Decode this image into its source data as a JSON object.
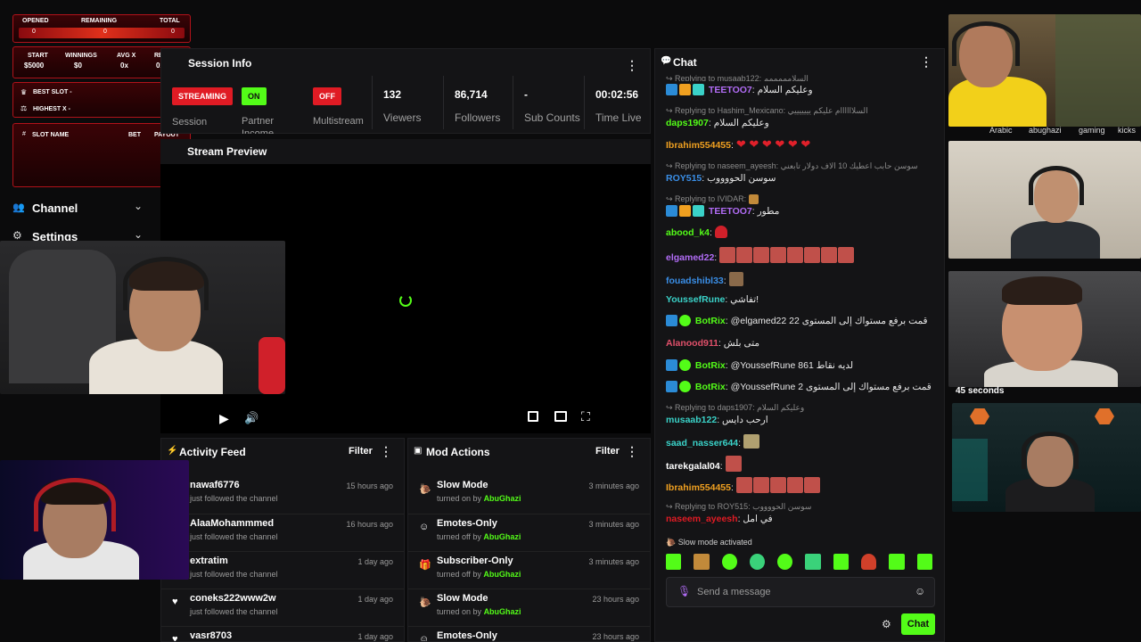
{
  "overlay": {
    "headers": {
      "opened": "OPENED",
      "remaining": "REMAINING",
      "total": "TOTAL"
    },
    "values": {
      "opened": "0",
      "remaining": "0",
      "total": "0"
    },
    "stats_labels": {
      "start": "START",
      "winnings": "WINNINGS",
      "avg": "AVG X",
      "req": "REQ X"
    },
    "stats_values": {
      "start": "$5000",
      "winnings": "$0",
      "avg": "0x",
      "req": "0x"
    },
    "best_slot": "BEST SLOT -",
    "highest_x": "HIGHEST X -",
    "table_headers": {
      "slot": "SLOT NAME",
      "bet": "BET",
      "payout": "PAYOUT"
    }
  },
  "sidebar": {
    "channel": "Channel",
    "settings": "Settings"
  },
  "session": {
    "title": "Session Info",
    "streaming_badge": "STREAMING",
    "partner_badge": "ON",
    "partner_label": "Partner",
    "partner_sub": "Income",
    "multistream_badge": "OFF",
    "multistream_label": "Multistream",
    "viewers_value": "132",
    "viewers_label": "Viewers",
    "followers_value": "86,714",
    "followers_label": "Followers",
    "subs_value": "-",
    "subs_label": "Sub Counts",
    "time_value": "00:02:56",
    "time_label": "Time Live",
    "session_sub": "Session"
  },
  "preview": {
    "title": "Stream Preview"
  },
  "activity": {
    "title": "Activity Feed",
    "filter": "Filter",
    "items": [
      {
        "name": "nawaf6776",
        "sub": "just followed the channel",
        "time": "15 hours ago"
      },
      {
        "name": "AlaaMohammmed",
        "sub": "just followed the channel",
        "time": "16 hours ago"
      },
      {
        "name": "extratim",
        "sub": "just followed the channel",
        "time": "1 day ago"
      },
      {
        "name": "coneks222www2w",
        "sub": "just followed the channel",
        "time": "1 day ago"
      },
      {
        "name": "vasr8703",
        "sub": "",
        "time": "1 day ago"
      }
    ]
  },
  "mod": {
    "title": "Mod Actions",
    "filter": "Filter",
    "items": [
      {
        "name": "Slow Mode",
        "action": "turned on by",
        "by": "AbuGhazi",
        "time": "3 minutes ago"
      },
      {
        "name": "Emotes-Only",
        "action": "turned off by",
        "by": "AbuGhazi",
        "time": "3 minutes ago"
      },
      {
        "name": "Subscriber-Only",
        "action": "turned off by",
        "by": "AbuGhazi",
        "time": "3 minutes ago"
      },
      {
        "name": "Slow Mode",
        "action": "turned on by",
        "by": "AbuGhazi",
        "time": "23 hours ago"
      },
      {
        "name": "Emotes-Only",
        "action": "",
        "by": "",
        "time": "23 hours ago"
      }
    ]
  },
  "chat": {
    "title": "Chat",
    "lines": {
      "l0_reply": "Replying to musaab122: السلامممممم",
      "l0_user": "TEETOO7",
      "l0_msg": "وعليكم السلام",
      "l1_reply": "Replying to Hashim_Mexicano: السلاااااام عليكم يييييييي",
      "l1_user": "daps1907",
      "l1_msg": "وعليكم السلام",
      "l2_user": "Ibrahim554455",
      "l2_msg": "❤ ❤ ❤ ❤ ❤ ❤",
      "l3_reply": "Replying to naseem_ayeesh: سوسن حابب اعطيك 10 الاف دولار تابعني",
      "l3_user": "ROY515",
      "l3_msg": "سوسن الحووووب",
      "l4_reply": "Replying to IVIDAR:",
      "l4_user": "TEETOO7",
      "l4_msg": "مطور",
      "l5_user": "abood_k4",
      "l6_user": "elgamed22",
      "l7_user": "fouadshibl33",
      "l8_user": "YoussefRune",
      "l8_msg": "تفاشي!",
      "l9_user": "BotRix",
      "l9_msg": "@elgamed22 22 قمت برفع مستواك إلى المستوى",
      "l10_user": "Alanood911",
      "l10_msg": "متى بلش",
      "l11_user": "BotRix",
      "l11_msg": "@YoussefRune 861 لديه نقاط",
      "l12_user": "BotRix",
      "l12_msg": "@YoussefRune 2 قمت برفع مستواك إلى المستوى",
      "l13_reply": "Replying to daps1907: وعليكم السلام",
      "l13_user": "musaab122",
      "l13_msg": "ارحب دايس",
      "l14_user": "saad_nasser644",
      "l15_user": "tarekgalal04",
      "l16_user": "Ibrahim554455",
      "l17_reply": "Replying to ROY515: سوسن الحووووب",
      "l17_user": "naseem_ayeesh",
      "l17_msg": "في امل"
    },
    "slow_mode": "Slow mode activated",
    "placeholder": "Send a message",
    "send": "Chat"
  },
  "side_stream": {
    "tags": [
      "Arabic",
      "abughazi",
      "gaming",
      "kicks"
    ],
    "countdown": "45 seconds"
  },
  "colors": {
    "kick_green": "#53fc18",
    "offline_red": "#e01b24",
    "overlay_red": "#b1121a"
  }
}
